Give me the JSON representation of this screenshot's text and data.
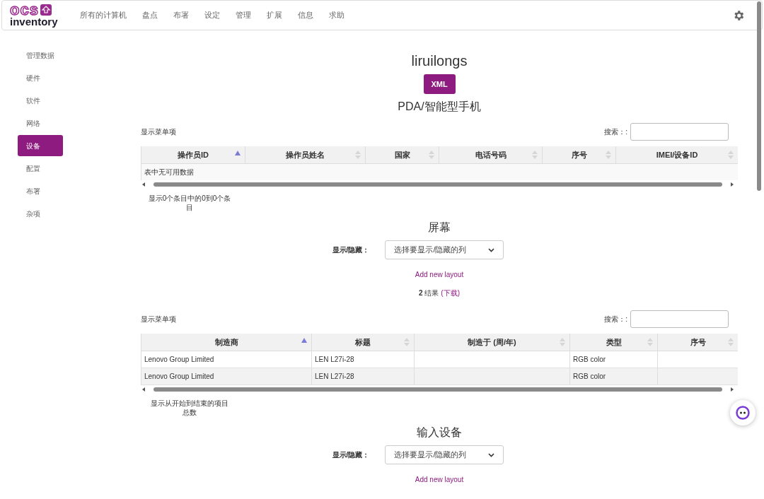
{
  "header": {
    "logo_top": "ocs",
    "logo_bottom": "inventory",
    "menu": [
      "所有的计算机",
      "盘点",
      "布署",
      "设定",
      "管理",
      "扩展",
      "信息",
      "求助"
    ]
  },
  "sidebar": {
    "items": [
      {
        "label": "管理数据",
        "selected": false
      },
      {
        "label": "硬件",
        "selected": false
      },
      {
        "label": "软件",
        "selected": false
      },
      {
        "label": "网络",
        "selected": false
      },
      {
        "label": "设备",
        "selected": true
      },
      {
        "label": "配置",
        "selected": false
      },
      {
        "label": "布署",
        "selected": false
      },
      {
        "label": "杂项",
        "selected": false
      }
    ]
  },
  "computer": {
    "name": "liruilongs",
    "xml_button": "XML"
  },
  "sections": [
    {
      "kind": "table",
      "title": "PDA/智能型手机",
      "show_menu": "显示菜单项",
      "search_label": "搜索：:",
      "columns": [
        {
          "label": "操作员ID",
          "sorted": true
        },
        {
          "label": "操作员姓名",
          "sorted": false
        },
        {
          "label": "国家",
          "sorted": false
        },
        {
          "label": "电话号码",
          "sorted": false
        },
        {
          "label": "序号",
          "sorted": false
        },
        {
          "label": "IMEI/设备ID",
          "sorted": false
        }
      ],
      "empty_text": "表中无可用数据",
      "info": "显示0个条目中的0到0个条目"
    },
    {
      "kind": "table",
      "title": "屏幕",
      "toggle_label": "显示/隐藏：",
      "select_placeholder": "选择要显示/隐藏的列",
      "add_layout": "Add new layout",
      "result_count": "2",
      "result_word": "结果",
      "download": "(下载)",
      "show_menu": "显示菜单项",
      "search_label": "搜索：:",
      "columns": [
        {
          "label": "制造商",
          "sorted": true
        },
        {
          "label": "标题",
          "sorted": false
        },
        {
          "label": "制造于 (周/年)",
          "sorted": false
        },
        {
          "label": "类型",
          "sorted": false
        },
        {
          "label": "序号",
          "sorted": false
        }
      ],
      "rows": [
        [
          "Lenovo Group Limited",
          "LEN L27i-28",
          "",
          "RGB color",
          ""
        ],
        [
          "Lenovo Group Limited",
          "LEN L27i-28",
          "",
          "RGB color",
          ""
        ]
      ],
      "info": "显示从开始到结束的项目总数"
    },
    {
      "kind": "header",
      "title": "输入设备",
      "toggle_label": "显示/隐藏：",
      "select_placeholder": "选择要显示/隐藏的列",
      "add_layout": "Add new layout"
    }
  ]
}
